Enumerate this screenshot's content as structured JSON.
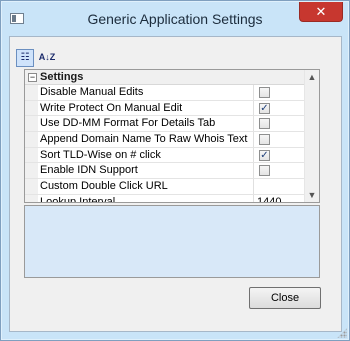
{
  "window": {
    "title": "Generic Application Settings",
    "close_glyph": "✕",
    "app_icon": "window-icon"
  },
  "toolbar": {
    "categorized_icon": "categorized-view-icon",
    "alphabetical_icon": "alphabetical-sort-icon",
    "categorized_glyph": "☷",
    "alphabetical_glyph": "A↓Z"
  },
  "property_grid": {
    "category": {
      "label": "Settings",
      "toggle": "−"
    },
    "rows": [
      {
        "name": "Disable Manual Edits",
        "type": "checkbox",
        "checked": false
      },
      {
        "name": "Write Protect On Manual Edit",
        "type": "checkbox",
        "checked": true
      },
      {
        "name": "Use DD-MM Format For Details Tab",
        "type": "checkbox",
        "checked": false
      },
      {
        "name": "Append Domain Name To Raw Whois Text",
        "type": "checkbox",
        "checked": false
      },
      {
        "name": "Sort TLD-Wise on # click",
        "type": "checkbox",
        "checked": true
      },
      {
        "name": "Enable IDN Support",
        "type": "checkbox",
        "checked": false
      },
      {
        "name": "Custom Double Click URL",
        "type": "text",
        "value": ""
      },
      {
        "name": "Lookup Interval",
        "type": "text",
        "value": "1440"
      }
    ],
    "scroll_up": "▲",
    "scroll_down": "▼"
  },
  "description_panel": {
    "text": ""
  },
  "buttons": {
    "close_label": "Close"
  },
  "colors": {
    "title_bar": "#c9e4f8",
    "close_button": "#c7372f",
    "description_bg": "#d8e8f8",
    "checkmark": "#1e3f7a"
  }
}
